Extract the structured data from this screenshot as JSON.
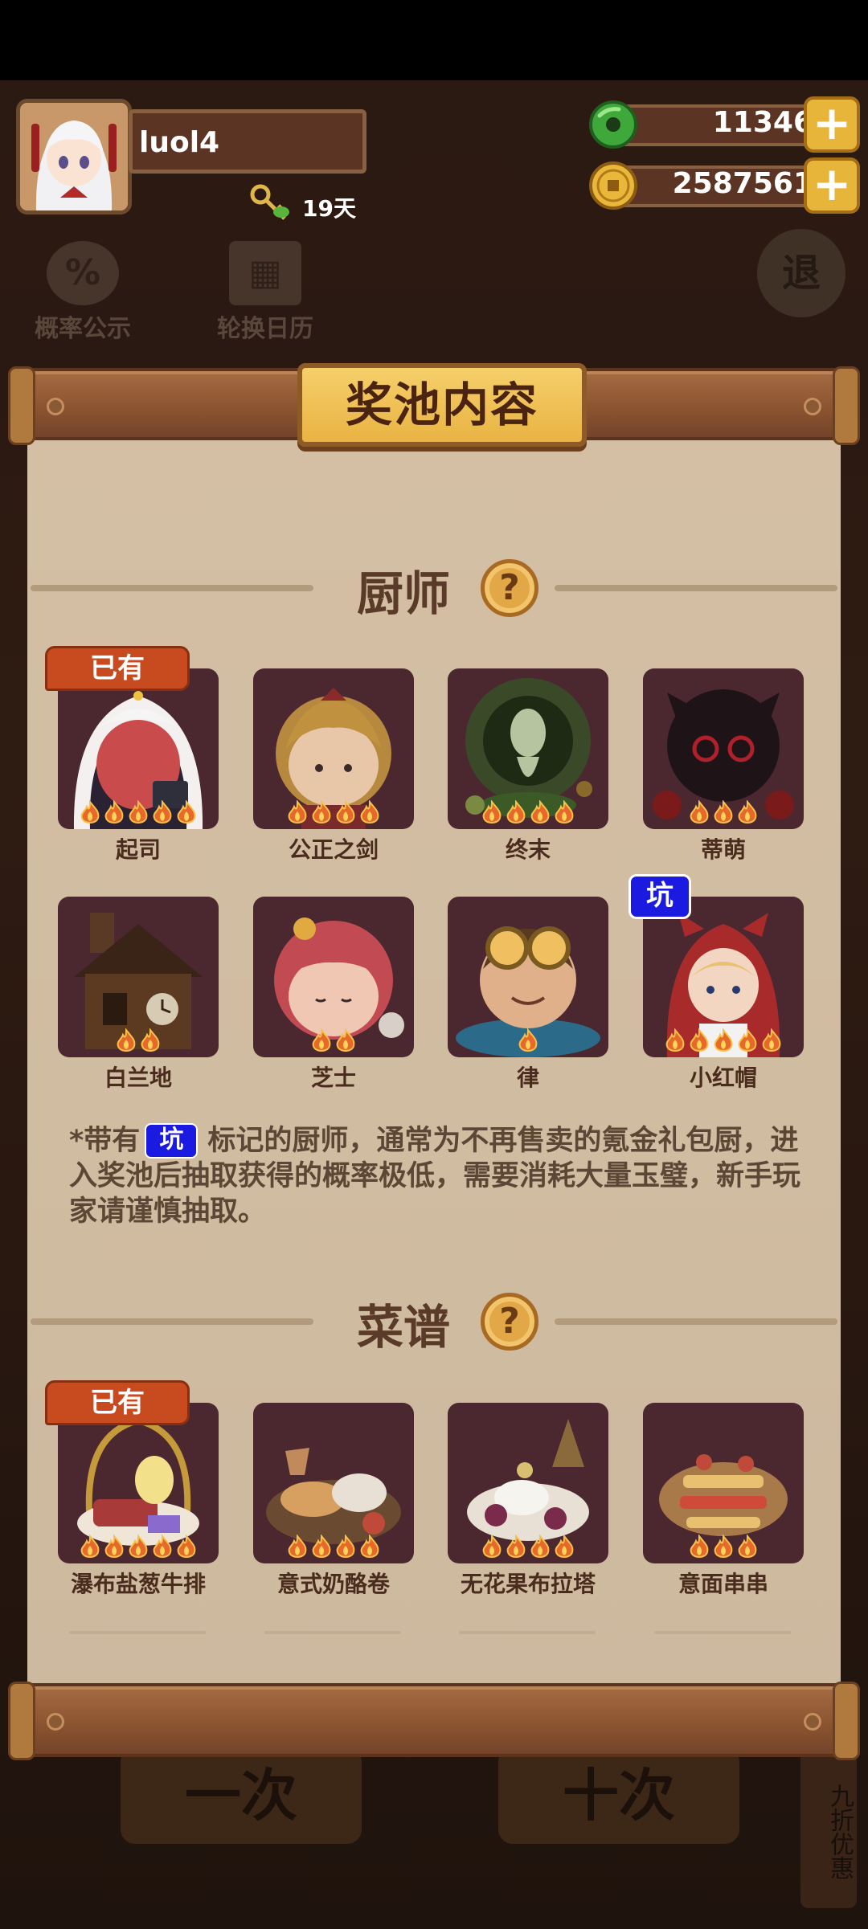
{
  "player": {
    "name": "luol4",
    "days": "19天"
  },
  "currencies": [
    {
      "type": "jade",
      "value": "11346"
    },
    {
      "type": "coin",
      "value": "2587561"
    }
  ],
  "background": {
    "probability_label": "概率公示",
    "calendar_label": "轮换日历",
    "exit_label": "退",
    "draw_one_label": "一次",
    "draw_ten_label": "十次",
    "discount_label": "九折优惠"
  },
  "modal": {
    "title": "奖池内容",
    "chef_section": "厨师",
    "recipe_section": "菜谱",
    "owned_label": "已有",
    "pit_label": "坑",
    "note_prefix": "*带有",
    "note_pit": "坑",
    "note_body": "标记的厨师，通常为不再售卖的氪金礼包厨，进入奖池后抽取获得的概率极低，需要消耗大量玉璧，新手玩家请谨慎抽取。"
  },
  "chefs": [
    {
      "name": "起司",
      "stars": 5,
      "owned": true,
      "pit": false
    },
    {
      "name": "公正之剑",
      "stars": 4,
      "owned": false,
      "pit": false
    },
    {
      "name": "终末",
      "stars": 4,
      "owned": false,
      "pit": false
    },
    {
      "name": "蒂萌",
      "stars": 3,
      "owned": false,
      "pit": false
    },
    {
      "name": "白兰地",
      "stars": 2,
      "owned": false,
      "pit": false
    },
    {
      "name": "芝士",
      "stars": 2,
      "owned": false,
      "pit": false
    },
    {
      "name": "律",
      "stars": 1,
      "owned": false,
      "pit": false
    },
    {
      "name": "小红帽",
      "stars": 5,
      "owned": false,
      "pit": true
    }
  ],
  "recipes": [
    {
      "name": "瀑布盐葱牛排",
      "stars": 5,
      "owned": true
    },
    {
      "name": "意式奶酪卷",
      "stars": 4,
      "owned": false
    },
    {
      "name": "无花果布拉塔",
      "stars": 4,
      "owned": false
    },
    {
      "name": "意面串串",
      "stars": 3,
      "owned": false
    }
  ],
  "colors": {
    "panel": "#d8c3a7",
    "card": "#4b2830",
    "owned_tag": "#c84a1f",
    "pit_tag": "#1a1ae0",
    "title_gold": "#f0c55a"
  }
}
